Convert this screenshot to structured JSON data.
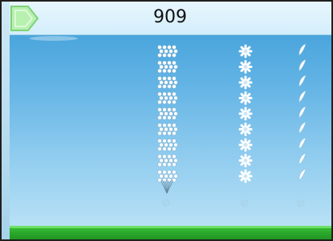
{
  "game": {
    "score": "909",
    "play_icon": "play-icon",
    "colors": {
      "sky_top": "#4aa5dc",
      "sky_bottom": "#b8e1f6",
      "ground": "#2aa62a",
      "play_button": "#b8f0b0",
      "flower": "#ffffff"
    }
  },
  "columns": [
    {
      "id": "seed-cluster-column",
      "type": "seed-cluster",
      "count": 9
    },
    {
      "id": "dandelion-column",
      "type": "dandelion-head",
      "count": 9
    },
    {
      "id": "seed-pod-column",
      "type": "seed-pod",
      "count": 9
    }
  ]
}
